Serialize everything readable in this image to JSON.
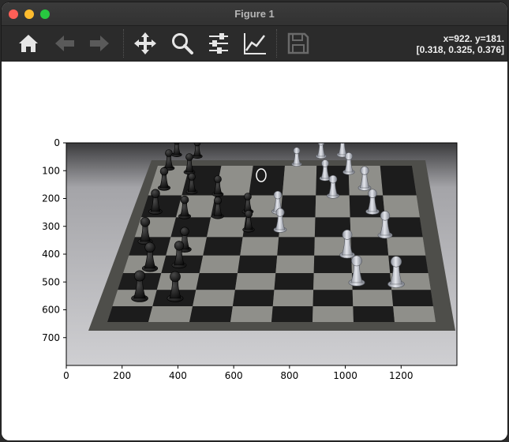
{
  "window": {
    "title": "Figure 1"
  },
  "toolbar": {
    "buttons": [
      {
        "name": "home-button",
        "icon": "home-icon"
      },
      {
        "name": "back-button",
        "icon": "arrow-left-icon"
      },
      {
        "name": "forward-button",
        "icon": "arrow-right-icon"
      },
      {
        "name": "pan-button",
        "icon": "move-icon"
      },
      {
        "name": "zoom-button",
        "icon": "magnifier-icon"
      },
      {
        "name": "configure-subplots-button",
        "icon": "sliders-icon"
      },
      {
        "name": "edit-axis-button",
        "icon": "line-chart-icon"
      },
      {
        "name": "save-button",
        "icon": "floppy-disk-icon"
      }
    ],
    "coord_line1": "x=922. y=181.",
    "coord_line2": "[0.318, 0.325, 0.376]"
  },
  "plot": {
    "image_subject": "photo of a chessboard with black and silver chess pieces",
    "xlim": [
      0,
      1400
    ],
    "ylim": [
      800,
      0
    ],
    "xticks": [
      "0",
      "200",
      "400",
      "600",
      "800",
      "1000",
      "1200"
    ],
    "yticks": [
      "0",
      "100",
      "200",
      "300",
      "400",
      "500",
      "600",
      "700"
    ],
    "colors": {
      "board_dark": "#1c1c1c",
      "board_light": "#8f8f8a",
      "background": "#c8c8cc",
      "frame": "#4e4e4a"
    }
  }
}
